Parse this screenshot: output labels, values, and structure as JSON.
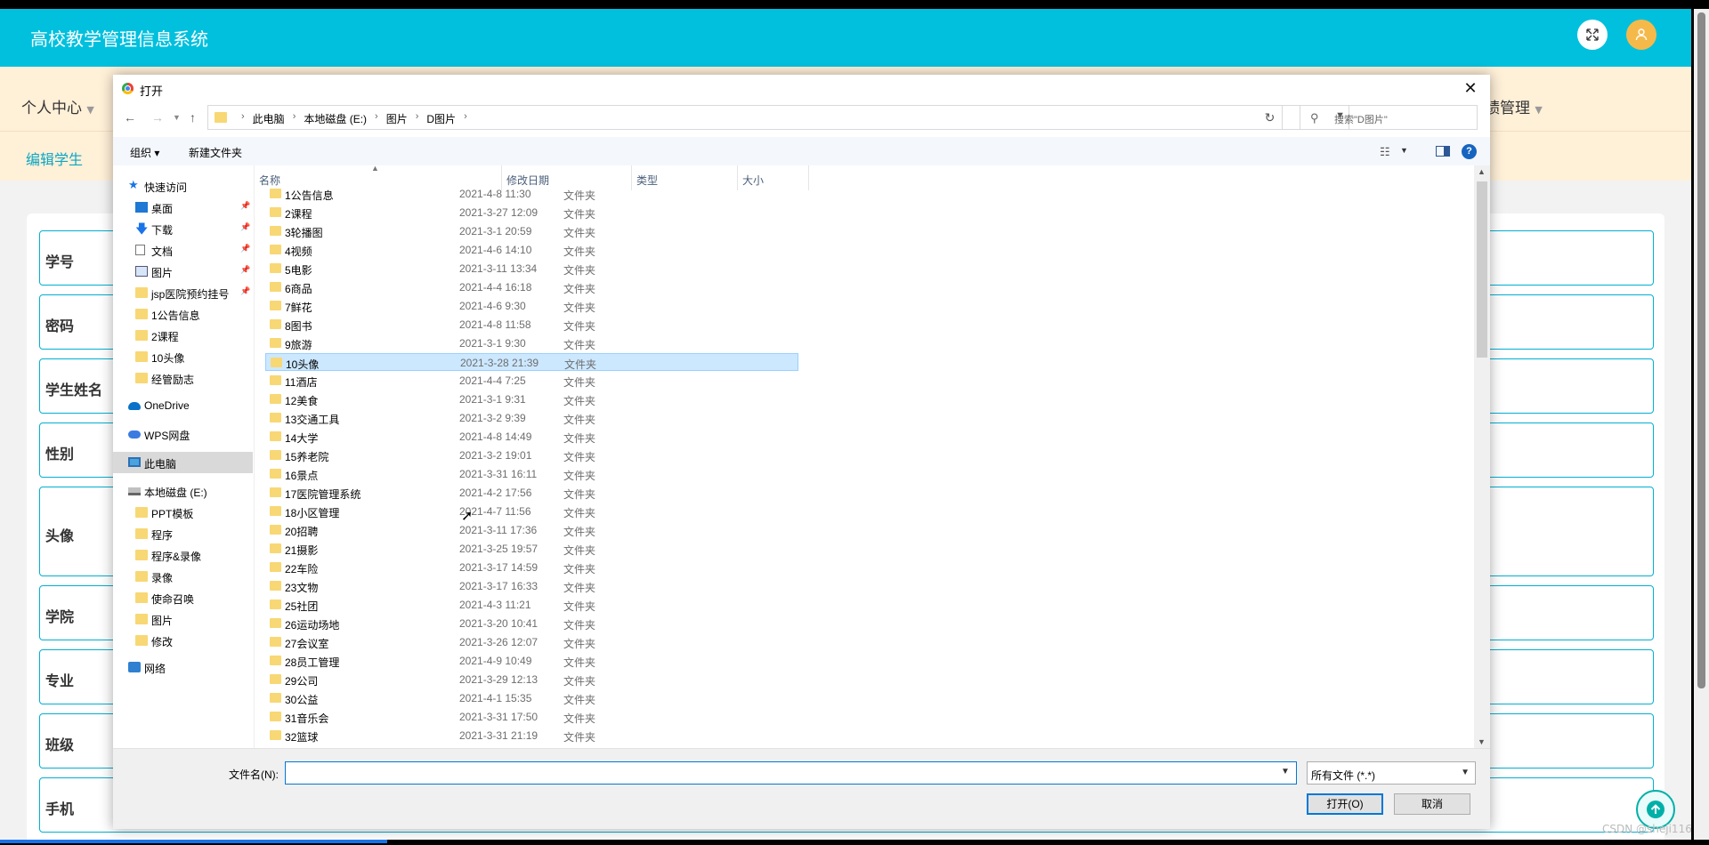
{
  "app": {
    "title": "高校教学管理信息系统",
    "nav_left": "个人中心",
    "nav_right": "绩管理",
    "sub_link": "编辑学生",
    "form_labels": [
      "学号",
      "密码",
      "学生姓名",
      "性别",
      "头像",
      "学院",
      "专业",
      "班级",
      "手机"
    ],
    "watermark": "CSDN @sheji116"
  },
  "dialog": {
    "title": "打开",
    "close": "✕",
    "breadcrumb": [
      "此电脑",
      "本地磁盘 (E:)",
      "图片",
      "D图片"
    ],
    "search_placeholder": "搜索\"D图片\"",
    "toolbar": {
      "organize": "组织 ▾",
      "new_folder": "新建文件夹"
    },
    "nav_pane": [
      {
        "label": "快速访问",
        "icon": "star-icon",
        "pinned": false
      },
      {
        "label": "桌面",
        "icon": "desktop-icon",
        "pinned": true
      },
      {
        "label": "下载",
        "icon": "download-icon",
        "pinned": true
      },
      {
        "label": "文档",
        "icon": "document-icon",
        "pinned": true
      },
      {
        "label": "图片",
        "icon": "pictures-icon",
        "pinned": true
      },
      {
        "label": "jsp医院预约挂号",
        "icon": "folder-icon",
        "pinned": true
      },
      {
        "label": "1公告信息",
        "icon": "folder-icon",
        "pinned": false
      },
      {
        "label": "2课程",
        "icon": "folder-icon",
        "pinned": false
      },
      {
        "label": "10头像",
        "icon": "folder-icon",
        "pinned": false
      },
      {
        "label": "经管励志",
        "icon": "folder-icon",
        "pinned": false
      },
      {
        "label": "OneDrive",
        "icon": "onedrive-icon",
        "pinned": false
      },
      {
        "label": "WPS网盘",
        "icon": "wps-cloud-icon",
        "pinned": false
      },
      {
        "label": "此电脑",
        "icon": "pc-icon",
        "pinned": false
      },
      {
        "label": "本地磁盘 (E:)",
        "icon": "drive-icon",
        "pinned": false
      },
      {
        "label": "PPT模板",
        "icon": "folder-icon",
        "pinned": false
      },
      {
        "label": "程序",
        "icon": "folder-icon",
        "pinned": false
      },
      {
        "label": "程序&录像",
        "icon": "folder-icon",
        "pinned": false
      },
      {
        "label": "录像",
        "icon": "folder-icon",
        "pinned": false
      },
      {
        "label": "使命召唤",
        "icon": "folder-icon",
        "pinned": false
      },
      {
        "label": "图片",
        "icon": "folder-icon",
        "pinned": false
      },
      {
        "label": "修改",
        "icon": "folder-icon",
        "pinned": false
      },
      {
        "label": "网络",
        "icon": "network-icon",
        "pinned": false
      }
    ],
    "columns": {
      "name": "名称",
      "modified": "修改日期",
      "type": "类型",
      "size": "大小"
    },
    "files": [
      {
        "name": "1公告信息",
        "date": "2021-4-8 11:30",
        "type": "文件夹"
      },
      {
        "name": "2课程",
        "date": "2021-3-27 12:09",
        "type": "文件夹"
      },
      {
        "name": "3轮播图",
        "date": "2021-3-1 20:59",
        "type": "文件夹"
      },
      {
        "name": "4视频",
        "date": "2021-4-6 14:10",
        "type": "文件夹"
      },
      {
        "name": "5电影",
        "date": "2021-3-11 13:34",
        "type": "文件夹"
      },
      {
        "name": "6商品",
        "date": "2021-4-4 16:18",
        "type": "文件夹"
      },
      {
        "name": "7鲜花",
        "date": "2021-4-6 9:30",
        "type": "文件夹"
      },
      {
        "name": "8图书",
        "date": "2021-4-8 11:58",
        "type": "文件夹"
      },
      {
        "name": "9旅游",
        "date": "2021-3-1 9:30",
        "type": "文件夹"
      },
      {
        "name": "10头像",
        "date": "2021-3-28 21:39",
        "type": "文件夹"
      },
      {
        "name": "11酒店",
        "date": "2021-4-4 7:25",
        "type": "文件夹"
      },
      {
        "name": "12美食",
        "date": "2021-3-1 9:31",
        "type": "文件夹"
      },
      {
        "name": "13交通工具",
        "date": "2021-3-2 9:39",
        "type": "文件夹"
      },
      {
        "name": "14大学",
        "date": "2021-4-8 14:49",
        "type": "文件夹"
      },
      {
        "name": "15养老院",
        "date": "2021-3-2 19:01",
        "type": "文件夹"
      },
      {
        "name": "16景点",
        "date": "2021-3-31 16:11",
        "type": "文件夹"
      },
      {
        "name": "17医院管理系统",
        "date": "2021-4-2 17:56",
        "type": "文件夹"
      },
      {
        "name": "18小区管理",
        "date": "2021-4-7 11:56",
        "type": "文件夹"
      },
      {
        "name": "20招聘",
        "date": "2021-3-11 17:36",
        "type": "文件夹"
      },
      {
        "name": "21摄影",
        "date": "2021-3-25 19:57",
        "type": "文件夹"
      },
      {
        "name": "22车险",
        "date": "2021-3-17 14:59",
        "type": "文件夹"
      },
      {
        "name": "23文物",
        "date": "2021-3-17 16:33",
        "type": "文件夹"
      },
      {
        "name": "25社团",
        "date": "2021-4-3 11:21",
        "type": "文件夹"
      },
      {
        "name": "26运动场地",
        "date": "2021-3-20 10:41",
        "type": "文件夹"
      },
      {
        "name": "27会议室",
        "date": "2021-3-26 12:07",
        "type": "文件夹"
      },
      {
        "name": "28员工管理",
        "date": "2021-4-9 10:49",
        "type": "文件夹"
      },
      {
        "name": "29公司",
        "date": "2021-3-29 12:13",
        "type": "文件夹"
      },
      {
        "name": "30公益",
        "date": "2021-4-1 15:35",
        "type": "文件夹"
      },
      {
        "name": "31音乐会",
        "date": "2021-3-31 17:50",
        "type": "文件夹"
      },
      {
        "name": "32篮球",
        "date": "2021-3-31 21:19",
        "type": "文件夹"
      }
    ],
    "selected_file": "10头像",
    "filename_label": "文件名(N):",
    "filename_value": "",
    "file_type_filter": "所有文件 (*.*)",
    "open_button": "打开(O)",
    "cancel_button": "取消"
  }
}
